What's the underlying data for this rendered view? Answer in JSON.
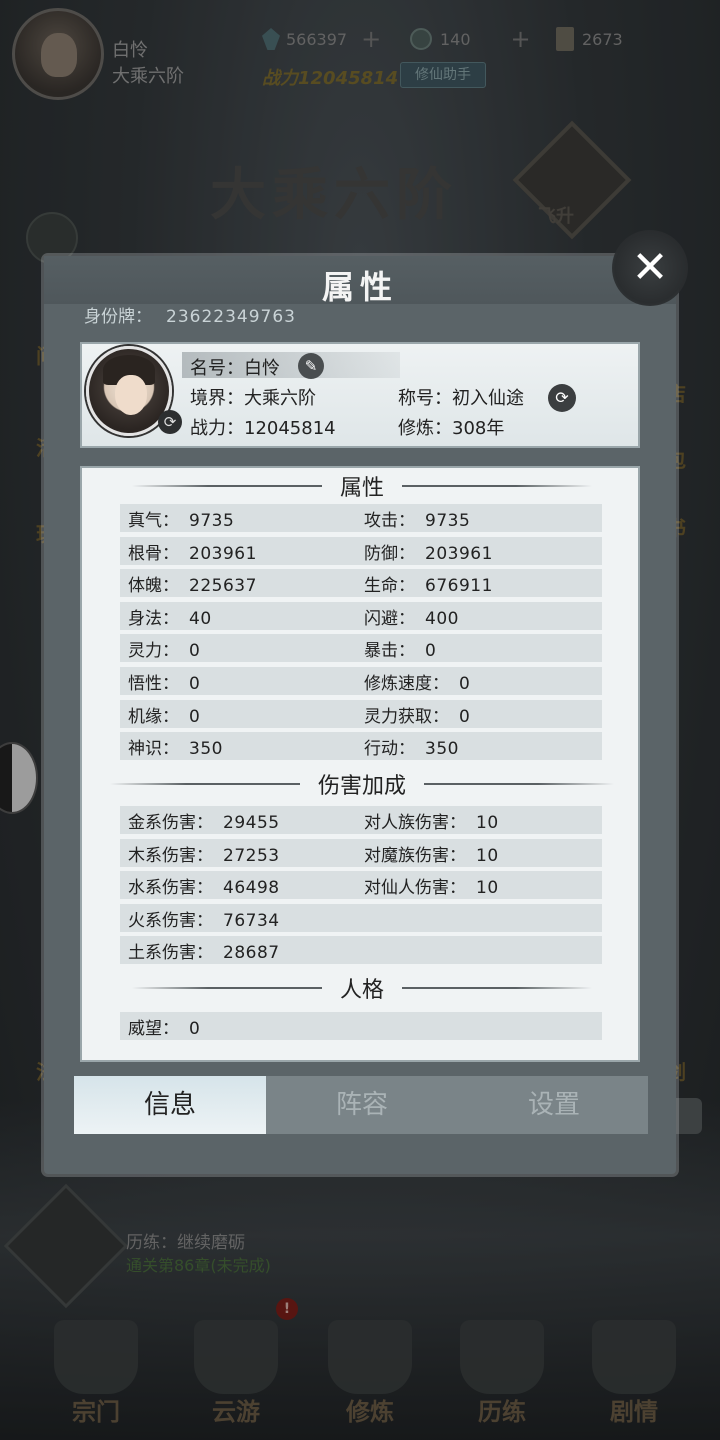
{
  "top_bar": {
    "player_name": "白怜",
    "player_realm": "大乘六阶",
    "spirit_stones": "566397",
    "jade_orbs": "140",
    "scrolls": "2673",
    "power_label": "战力12045814",
    "helper_button": "修仙助手"
  },
  "background": {
    "realm_title": "大乘六阶",
    "ascend_label": "飞升",
    "left_texts": [
      "问",
      "活",
      "玩",
      "法"
    ],
    "right_texts": [
      "店",
      "包",
      "书",
      "剑"
    ],
    "trial_title": "历练：继续磨砺",
    "trial_progress": "通关第86章(未完成)",
    "nav_dot": "!",
    "nav": [
      "宗门",
      "云游",
      "修炼",
      "历练",
      "剧情"
    ]
  },
  "modal": {
    "title": "属性",
    "close_icon": "✕",
    "id_label": "身份牌：",
    "id_value": "23622349763",
    "profile": {
      "name_label": "名号：",
      "name_value": "白怜",
      "realm_label": "境界：",
      "realm_value": "大乘六阶",
      "title_label": "称号：",
      "title_value": "初入仙途",
      "power_label": "战力：",
      "power_value": "12045814",
      "cultivate_label": "修炼：",
      "cultivate_value": "308年"
    },
    "sections": {
      "attributes": "属性",
      "damage": "伤害加成",
      "personality": "人格"
    },
    "attributes": [
      {
        "l_label": "真气：",
        "l_value": "9735",
        "r_label": "攻击：",
        "r_value": "9735"
      },
      {
        "l_label": "根骨：",
        "l_value": "203961",
        "r_label": "防御：",
        "r_value": "203961"
      },
      {
        "l_label": "体魄：",
        "l_value": "225637",
        "r_label": "生命：",
        "r_value": "676911"
      },
      {
        "l_label": "身法：",
        "l_value": "40",
        "r_label": "闪避：",
        "r_value": "400"
      },
      {
        "l_label": "灵力：",
        "l_value": "0",
        "r_label": "暴击：",
        "r_value": "0"
      },
      {
        "l_label": "悟性：",
        "l_value": "0",
        "r_label": "修炼速度：",
        "r_value": "0"
      },
      {
        "l_label": "机缘：",
        "l_value": "0",
        "r_label": "灵力获取：",
        "r_value": "0"
      },
      {
        "l_label": "神识：",
        "l_value": "350",
        "r_label": "行动：",
        "r_value": "350"
      }
    ],
    "damage": [
      {
        "l_label": "金系伤害：",
        "l_value": "29455",
        "r_label": "对人族伤害：",
        "r_value": "10"
      },
      {
        "l_label": "木系伤害：",
        "l_value": "27253",
        "r_label": "对魔族伤害：",
        "r_value": "10"
      },
      {
        "l_label": "水系伤害：",
        "l_value": "46498",
        "r_label": "对仙人伤害：",
        "r_value": "10"
      },
      {
        "l_label": "火系伤害：",
        "l_value": "76734",
        "r_label": "",
        "r_value": ""
      },
      {
        "l_label": "土系伤害：",
        "l_value": "28687",
        "r_label": "",
        "r_value": ""
      }
    ],
    "personality": [
      {
        "l_label": "威望：",
        "l_value": "0"
      }
    ],
    "tabs": [
      "信息",
      "阵容",
      "设置"
    ],
    "active_tab": "信息"
  }
}
